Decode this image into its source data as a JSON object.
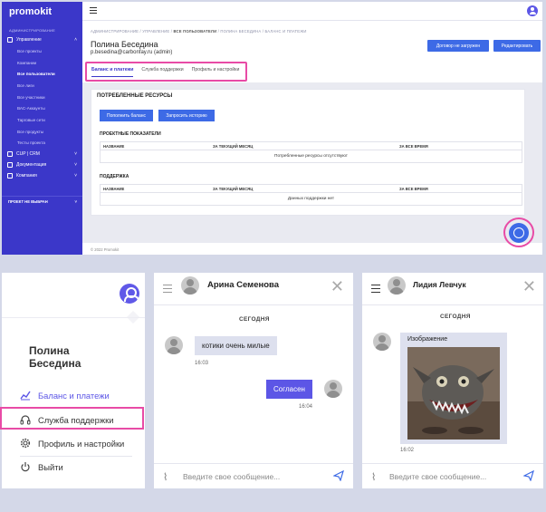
{
  "app": {
    "logo": "promokit"
  },
  "sidebar": {
    "caption": "АДМИНИСТРИРОВАНИЕ",
    "groups": [
      {
        "label": "Управление",
        "icon": "grid-icon"
      },
      {
        "label": "CUP | CRM",
        "icon": "crm-icon"
      },
      {
        "label": "Документация",
        "icon": "book-icon"
      },
      {
        "label": "Компания",
        "icon": "building-icon"
      }
    ],
    "subitems": [
      "Все проекты",
      "Компании",
      "Все пользователи",
      "Все лиги",
      "Все участники",
      "ВАС-Аккаунты",
      "Тарговые сети",
      "Все продукты",
      "Тесты проекта"
    ],
    "active_sub": "Все пользователи",
    "project_label": "ПРОЕКТ НЕ ВЫБРАН"
  },
  "header": {
    "breadcrumbs": [
      "АДМИНИСТРИРОВАНИЕ",
      "УПРАВЛЕНИЕ",
      "ВСЕ ПОЛЬЗОВАТЕЛИ",
      "ПОЛИНА БЕСЕДИНА",
      "БАЛАНС И ПЛАТЕЖИ"
    ],
    "user_name": "Полина Беседина",
    "user_email": "p.besedina@carbonfay.ru (admin)",
    "btn_contract": "Договор не загружен",
    "btn_edit": "Редактировать"
  },
  "tabs": [
    "Баланс и платежи",
    "Служба поддержки",
    "Профиль и настройки"
  ],
  "card": {
    "title": "ПОТРЕБЛЕННЫЕ РЕСУРСЫ",
    "btn_topup": "Пополнить баланс",
    "btn_history": "Запросить историю",
    "section1": "ПРОЕКТНЫЕ ПОКАЗАТЕЛИ",
    "section2": "ПОДДЕРЖКА",
    "cols": [
      "НАЗВАНИЕ",
      "ЗА ТЕКУЩИЙ МЕСЯЦ",
      "ЗА ВСЕ ВРЕМЯ"
    ],
    "empty1": "Потребленные ресурсы отсутствуют",
    "empty2": "Данных поддержки нет"
  },
  "footer": {
    "copyright": "© 2022 Promokit"
  },
  "menu_panel": {
    "name": "Полина Беседина",
    "items": [
      {
        "label": "Баланс и платежи",
        "icon": "chart-line-icon",
        "color": "#5c56e6"
      },
      {
        "label": "Служба поддержки",
        "icon": "headset-icon",
        "color": "#333333"
      },
      {
        "label": "Профиль и настройки",
        "icon": "gear-icon",
        "color": "#333333"
      },
      {
        "label": "Выйти",
        "icon": "power-icon",
        "color": "#333333"
      }
    ]
  },
  "chat1": {
    "name": "Арина Семенова",
    "day": "СЕГОДНЯ",
    "msg_in": "котики очень милые",
    "time_in": "16:03",
    "msg_out": "Согласен",
    "time_out": "16:04",
    "placeholder": "Введите свое сообщение..."
  },
  "chat2": {
    "name": "Лидия Левчук",
    "day": "СЕГОДНЯ",
    "image_caption": "Изображение",
    "time": "16:02",
    "placeholder": "Введите свое сообщение..."
  },
  "colors": {
    "sidebar": "#3b37c9",
    "accent": "#3d6ae6",
    "highlight": "#e84ba6",
    "menu_accent": "#5c56e6"
  }
}
